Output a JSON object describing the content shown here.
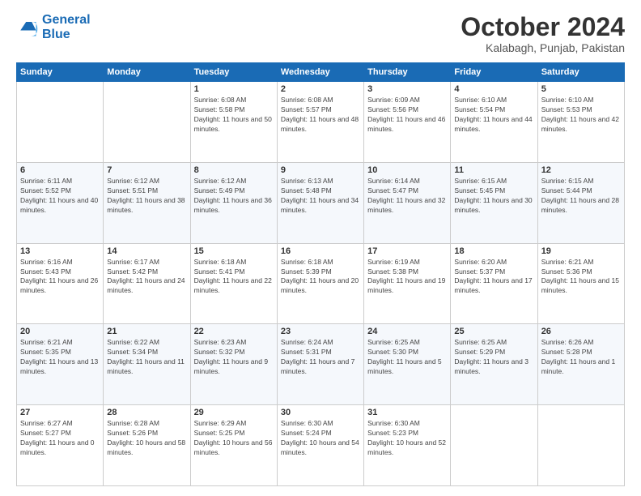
{
  "logo": {
    "line1": "General",
    "line2": "Blue"
  },
  "title": "October 2024",
  "location": "Kalabagh, Punjab, Pakistan",
  "days_header": [
    "Sunday",
    "Monday",
    "Tuesday",
    "Wednesday",
    "Thursday",
    "Friday",
    "Saturday"
  ],
  "weeks": [
    [
      {
        "day": "",
        "detail": ""
      },
      {
        "day": "",
        "detail": ""
      },
      {
        "day": "1",
        "detail": "Sunrise: 6:08 AM\nSunset: 5:58 PM\nDaylight: 11 hours and 50 minutes."
      },
      {
        "day": "2",
        "detail": "Sunrise: 6:08 AM\nSunset: 5:57 PM\nDaylight: 11 hours and 48 minutes."
      },
      {
        "day": "3",
        "detail": "Sunrise: 6:09 AM\nSunset: 5:56 PM\nDaylight: 11 hours and 46 minutes."
      },
      {
        "day": "4",
        "detail": "Sunrise: 6:10 AM\nSunset: 5:54 PM\nDaylight: 11 hours and 44 minutes."
      },
      {
        "day": "5",
        "detail": "Sunrise: 6:10 AM\nSunset: 5:53 PM\nDaylight: 11 hours and 42 minutes."
      }
    ],
    [
      {
        "day": "6",
        "detail": "Sunrise: 6:11 AM\nSunset: 5:52 PM\nDaylight: 11 hours and 40 minutes."
      },
      {
        "day": "7",
        "detail": "Sunrise: 6:12 AM\nSunset: 5:51 PM\nDaylight: 11 hours and 38 minutes."
      },
      {
        "day": "8",
        "detail": "Sunrise: 6:12 AM\nSunset: 5:49 PM\nDaylight: 11 hours and 36 minutes."
      },
      {
        "day": "9",
        "detail": "Sunrise: 6:13 AM\nSunset: 5:48 PM\nDaylight: 11 hours and 34 minutes."
      },
      {
        "day": "10",
        "detail": "Sunrise: 6:14 AM\nSunset: 5:47 PM\nDaylight: 11 hours and 32 minutes."
      },
      {
        "day": "11",
        "detail": "Sunrise: 6:15 AM\nSunset: 5:45 PM\nDaylight: 11 hours and 30 minutes."
      },
      {
        "day": "12",
        "detail": "Sunrise: 6:15 AM\nSunset: 5:44 PM\nDaylight: 11 hours and 28 minutes."
      }
    ],
    [
      {
        "day": "13",
        "detail": "Sunrise: 6:16 AM\nSunset: 5:43 PM\nDaylight: 11 hours and 26 minutes."
      },
      {
        "day": "14",
        "detail": "Sunrise: 6:17 AM\nSunset: 5:42 PM\nDaylight: 11 hours and 24 minutes."
      },
      {
        "day": "15",
        "detail": "Sunrise: 6:18 AM\nSunset: 5:41 PM\nDaylight: 11 hours and 22 minutes."
      },
      {
        "day": "16",
        "detail": "Sunrise: 6:18 AM\nSunset: 5:39 PM\nDaylight: 11 hours and 20 minutes."
      },
      {
        "day": "17",
        "detail": "Sunrise: 6:19 AM\nSunset: 5:38 PM\nDaylight: 11 hours and 19 minutes."
      },
      {
        "day": "18",
        "detail": "Sunrise: 6:20 AM\nSunset: 5:37 PM\nDaylight: 11 hours and 17 minutes."
      },
      {
        "day": "19",
        "detail": "Sunrise: 6:21 AM\nSunset: 5:36 PM\nDaylight: 11 hours and 15 minutes."
      }
    ],
    [
      {
        "day": "20",
        "detail": "Sunrise: 6:21 AM\nSunset: 5:35 PM\nDaylight: 11 hours and 13 minutes."
      },
      {
        "day": "21",
        "detail": "Sunrise: 6:22 AM\nSunset: 5:34 PM\nDaylight: 11 hours and 11 minutes."
      },
      {
        "day": "22",
        "detail": "Sunrise: 6:23 AM\nSunset: 5:32 PM\nDaylight: 11 hours and 9 minutes."
      },
      {
        "day": "23",
        "detail": "Sunrise: 6:24 AM\nSunset: 5:31 PM\nDaylight: 11 hours and 7 minutes."
      },
      {
        "day": "24",
        "detail": "Sunrise: 6:25 AM\nSunset: 5:30 PM\nDaylight: 11 hours and 5 minutes."
      },
      {
        "day": "25",
        "detail": "Sunrise: 6:25 AM\nSunset: 5:29 PM\nDaylight: 11 hours and 3 minutes."
      },
      {
        "day": "26",
        "detail": "Sunrise: 6:26 AM\nSunset: 5:28 PM\nDaylight: 11 hours and 1 minute."
      }
    ],
    [
      {
        "day": "27",
        "detail": "Sunrise: 6:27 AM\nSunset: 5:27 PM\nDaylight: 11 hours and 0 minutes."
      },
      {
        "day": "28",
        "detail": "Sunrise: 6:28 AM\nSunset: 5:26 PM\nDaylight: 10 hours and 58 minutes."
      },
      {
        "day": "29",
        "detail": "Sunrise: 6:29 AM\nSunset: 5:25 PM\nDaylight: 10 hours and 56 minutes."
      },
      {
        "day": "30",
        "detail": "Sunrise: 6:30 AM\nSunset: 5:24 PM\nDaylight: 10 hours and 54 minutes."
      },
      {
        "day": "31",
        "detail": "Sunrise: 6:30 AM\nSunset: 5:23 PM\nDaylight: 10 hours and 52 minutes."
      },
      {
        "day": "",
        "detail": ""
      },
      {
        "day": "",
        "detail": ""
      }
    ]
  ]
}
